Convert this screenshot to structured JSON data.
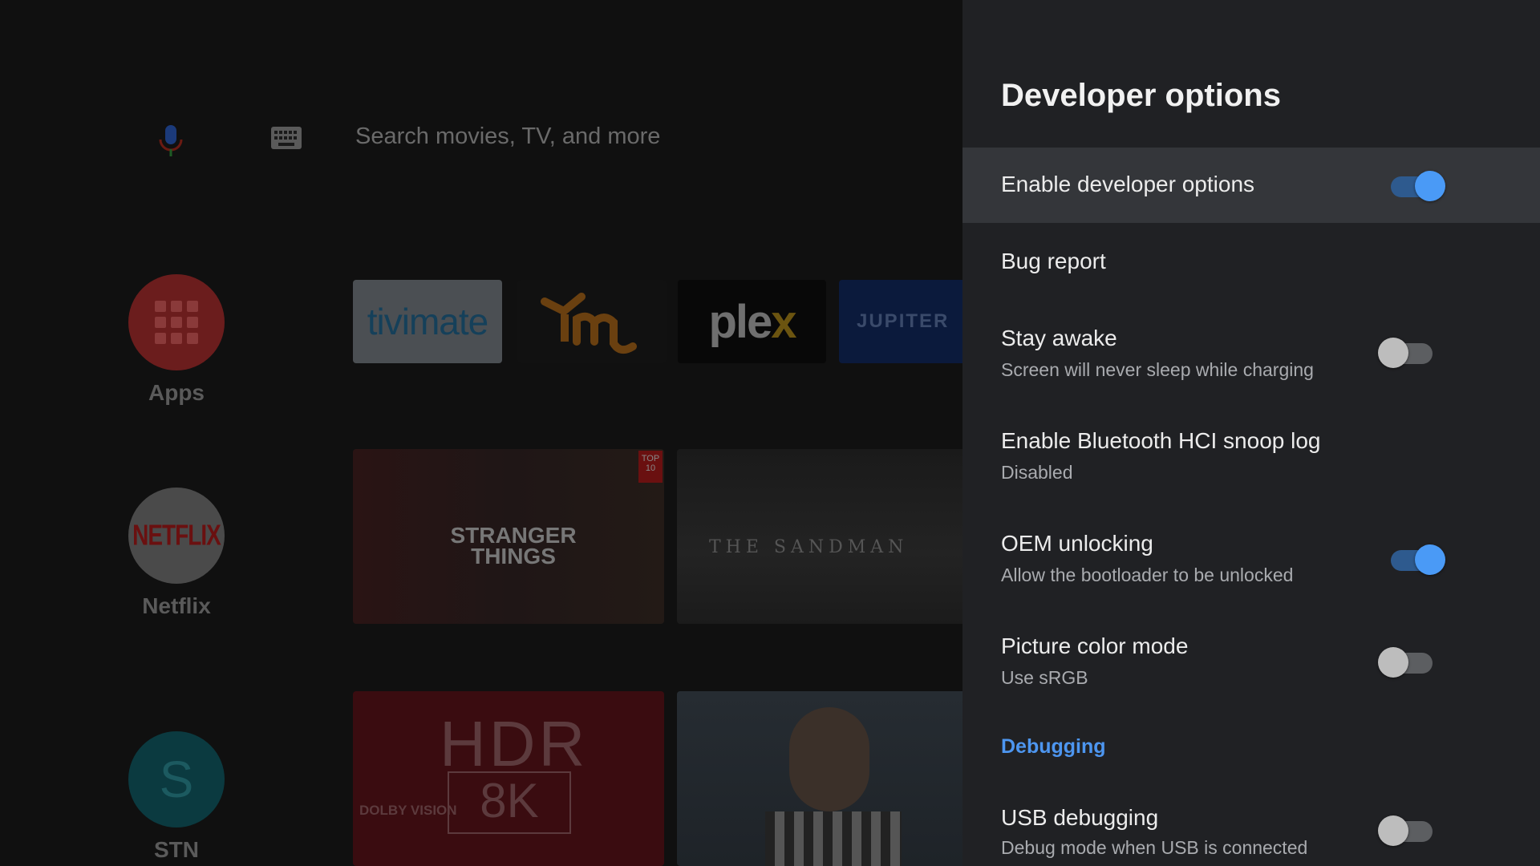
{
  "background": {
    "search_placeholder": "Search movies, TV, and more",
    "side_items": [
      {
        "label": "Apps"
      },
      {
        "label": "Netflix",
        "logo_text": "NETFLIX"
      },
      {
        "label": "STN Beta",
        "logo_text": "S"
      }
    ],
    "app_tiles": [
      {
        "name": "tivimate"
      },
      {
        "name": "im"
      },
      {
        "name": "plex"
      },
      {
        "name": "JUPITER"
      }
    ],
    "media_tiles": {
      "stranger_things_title": "STRANGER THINGS",
      "top10_badge": "TOP 10",
      "sandman_title": "THE SANDMAN",
      "hdr_text": "HDR",
      "k8_text": "8K",
      "dolby_text": "DOLBY VISION"
    }
  },
  "panel": {
    "title": "Developer options",
    "rows": [
      {
        "title": "Enable developer options",
        "subtitle": "",
        "toggle": "on",
        "focused": true
      },
      {
        "title": "Bug report",
        "subtitle": ""
      },
      {
        "title": "Stay awake",
        "subtitle": "Screen will never sleep while charging",
        "toggle": "off"
      },
      {
        "title": "Enable Bluetooth HCI snoop log",
        "subtitle": "Disabled"
      },
      {
        "title": "OEM unlocking",
        "subtitle": "Allow the bootloader to be unlocked",
        "toggle": "on"
      },
      {
        "title": "Picture color mode",
        "subtitle": "Use sRGB",
        "toggle": "off"
      }
    ],
    "section_debugging": "Debugging",
    "debug_rows": [
      {
        "title": "USB debugging",
        "subtitle": "Debug mode when USB is connected",
        "toggle": "off"
      }
    ]
  },
  "colors": {
    "accent": "#4a9af6",
    "panel_bg": "#202124",
    "focused_row_bg": "#34363a"
  }
}
